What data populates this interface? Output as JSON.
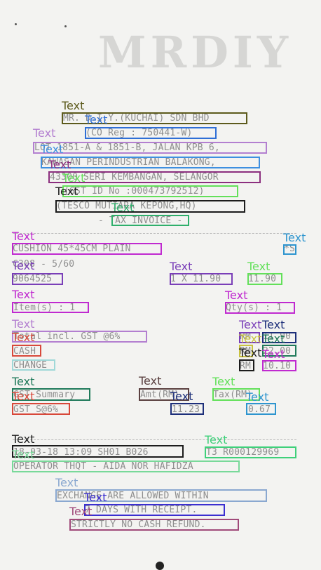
{
  "receipt": {
    "header": {
      "company": "MR. D.I.Y.(KUCHAI) SDN BHD",
      "co_reg": "(CO Reg : 750441-W)",
      "address_1": "LOT 1851-A & 1851-B, JALAN KPB 6,",
      "address_2": "KAWASAN PERINDUSTRIAN BALAKONG,",
      "address_3": "43300 SERI KEMBANGAN, SELANGOR",
      "gst_id": "(GST ID No :000473792512)",
      "branch": "(TESCO MUTIARA KEPONG,HQ)",
      "doc_type": "- TAX INVOICE -"
    },
    "item": {
      "description": "CUSHION 45*45CM PLAIN",
      "tax_code": "*S",
      "variant": "C308 - 5/60",
      "barcode": "9064525",
      "qty_price": "1 X 11.90",
      "amount": "11.90"
    },
    "counts": {
      "items": "Item(s) : 1",
      "qty": "Qty(s) : 1"
    },
    "totals": {
      "total_label": "Total incl. GST @6%",
      "total_currency": "RM",
      "total_value": "11.90",
      "cash_label": "CASH",
      "cash_currency": "RM",
      "cash_value": "22.00",
      "change_label": "CHANGE",
      "change_currency": "RM",
      "change_value": "10.10"
    },
    "gst": {
      "summary_label": "GST Summary",
      "amt_header": "Amt(RM)",
      "tax_header": "Tax(RM)",
      "rate_label": "GST S@6%",
      "amt_value": "11.23",
      "tax_value": "0.67"
    },
    "footer": {
      "datetime_store": "18-03-18 13:09 SH01 B026",
      "transaction": "T3 R000129969",
      "operator": "OPERATOR THQT - AIDA NOR HAFIDZA",
      "policy_1": "EXCHANGE ARE ALLOWED WITHIN",
      "policy_2": "7 DAYS WITH RECEIPT.",
      "policy_3": "STRICTLY NO CASH REFUND."
    }
  },
  "annotations": {
    "label": "Text",
    "colors": {
      "olive": "#5c5a1c",
      "blue": "#2f6fd6",
      "violet": "#b37fd0",
      "sky": "#3e8fe0",
      "plum": "#8c2f7f",
      "lime": "#63e05a",
      "black": "#1c1c1c",
      "green": "#2faf6c",
      "magenta": "#c02ad0",
      "cyan": "#2e95cf",
      "navy": "#1d2f7a",
      "purple": "#7a3fb8",
      "red": "#d8483a",
      "teal": "#1f7a5a",
      "taupe": "#5a4040",
      "mint": "#3fd07a",
      "lightgreen": "#79d99a",
      "steel": "#8aa8d0",
      "rose": "#a04a7a",
      "pale": "#9fd8d8",
      "gold": "#c9c240",
      "indigo": "#3b2fd0"
    }
  }
}
